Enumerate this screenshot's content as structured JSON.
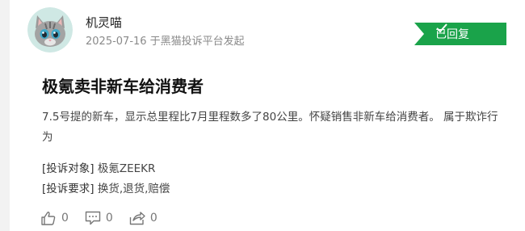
{
  "user": {
    "name": "机灵喵",
    "meta": "2025-07-16 于黑猫投诉平台发起"
  },
  "status": {
    "label": "已回复",
    "color": "#1aa34a"
  },
  "complaint": {
    "title": "极氪卖非新车给消费者",
    "description": "7.5号提的新车，显示总里程比7月里程数多了80公里。怀疑销售非新车给消费者。 属于欺诈行为",
    "object_key": "[投诉对象]",
    "object_value": "极氪ZEEKR",
    "demand_key": "[投诉要求]",
    "demand_value": "换货,退货,赔偿"
  },
  "actions": {
    "like_count": "0",
    "comment_count": "0",
    "share_count": "0"
  },
  "icons": [
    "cat-avatar",
    "check-icon",
    "thumbs-up-icon",
    "comment-icon",
    "share-icon"
  ]
}
